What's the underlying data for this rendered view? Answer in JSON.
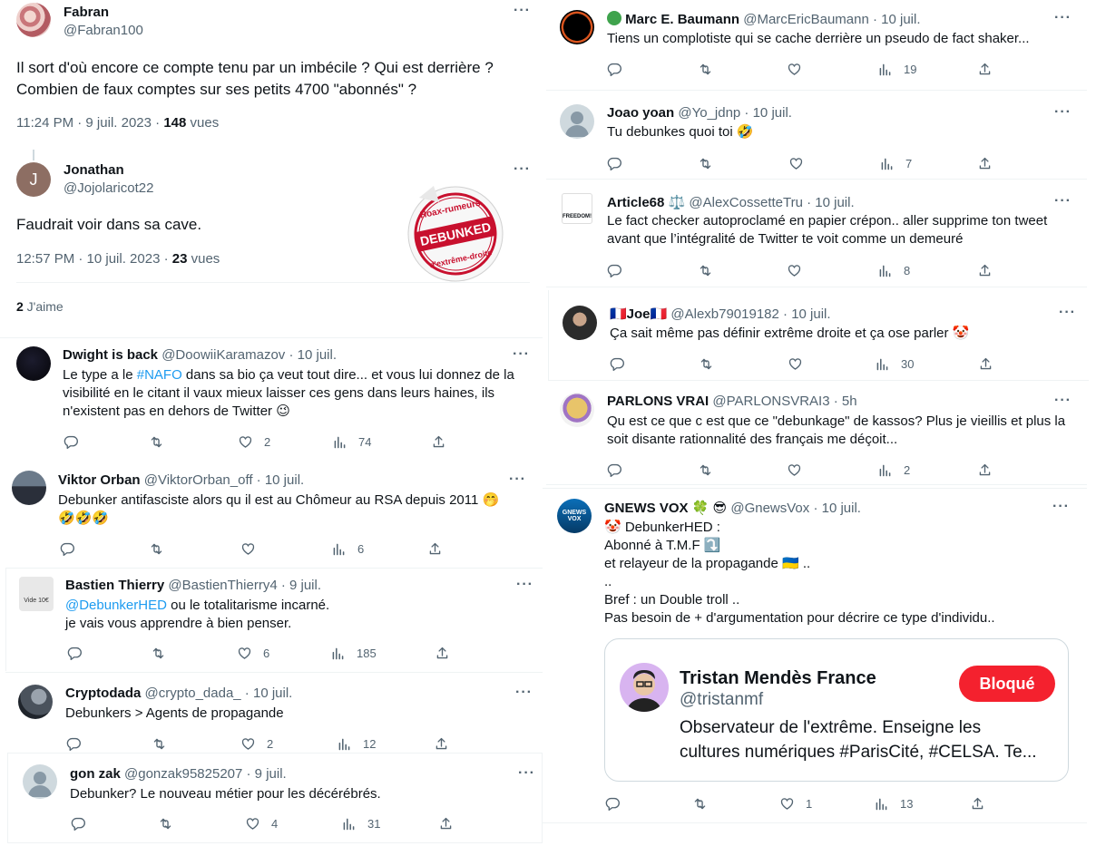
{
  "left": {
    "main": {
      "fabran": {
        "name": "Fabran",
        "handle": "@Fabran100",
        "text": "Il sort d'où encore ce compte tenu par un imbécile ? Qui est derrière ?\nCombien de faux comptes sur ses petits 4700 \"abonnés\" ?",
        "time": "11:24 PM · 9 juil. 2023 · ",
        "views": "148",
        "views_label": " vues"
      },
      "jonathan": {
        "name": "Jonathan",
        "handle": "@Jojolaricot22",
        "avatar_letter": "J",
        "text": "Faudrait voir dans sa cave.",
        "time": "12:57 PM · 10 juil. 2023 · ",
        "views": "23",
        "views_label": " vues",
        "likes_count": "2",
        "likes_label": " J'aime",
        "stamp_top": "Hoax-rumeurs",
        "stamp_mid": "DEBUNKED",
        "stamp_bottom": "d'extrême-droite"
      }
    },
    "replies": [
      {
        "name": "Dwight is back",
        "handle": "@DoowiiKaramazov · 10 juil.",
        "pre": "Le type a le ",
        "link": "#NAFO",
        "post": " dans sa bio ça veut tout dire... et vous lui donnez de la\nvisibilité en le citant il vaux mieux laisser ces gens dans leurs haines, ils\nn'existent pas en dehors de Twitter 😉",
        "likes": "2",
        "views": "74"
      },
      {
        "name": "Viktor Orban",
        "handle": "@ViktorOrban_off · 10 juil.",
        "text": "Debunker antifasciste alors qu il est au Chômeur au RSA depuis 2011 🤭\n🤣🤣🤣",
        "likes": "",
        "views": "6"
      },
      {
        "name": "Bastien Thierry",
        "handle": "@BastienThierry4 · 9 juil.",
        "link": "@DebunkerHED",
        "post": " ou le totalitarisme  incarné.\nje vais vous apprendre à bien penser.",
        "likes": "6",
        "views": "185",
        "avatar_text": "Vide 10€"
      },
      {
        "name": "Cryptodada",
        "handle": "@crypto_dada_ · 10 juil.",
        "text": "Debunkers > Agents de propagande",
        "likes": "2",
        "views": "12"
      },
      {
        "name": "gon zak",
        "handle": "@gonzak95825207 · 9 juil.",
        "text": "Debunker? Le nouveau métier pour les décérébrés.",
        "likes": "4",
        "views": "31"
      }
    ]
  },
  "right": {
    "replies": [
      {
        "name": "Marc E. Baumann",
        "handle": "@MarcEricBaumann · 10 juil.",
        "text": "Tiens un complotiste qui se cache derrière un pseudo de fact shaker...",
        "likes": "",
        "views": "19"
      },
      {
        "name": "Joao yoan",
        "handle": "@Yo_jdnp · 10 juil.",
        "text": "Tu debunkes quoi toi 🤣",
        "likes": "",
        "views": "7"
      },
      {
        "name": "Article68 ⚖️",
        "handle": "@AlexCossetteTru · 10 juil.",
        "text": "Le fact checker autoproclamé en papier crépon.. aller supprime ton tweet\navant que l’intégralité de Twitter te voit comme un demeuré",
        "likes": "",
        "views": "8",
        "avatar_text": "FREEDOM!"
      },
      {
        "name": "🇫🇷Joe🇫🇷",
        "handle": "@Alexb79019182 · 10 juil.",
        "text": "Ça sait même pas définir extrême droite et ça ose parler 🤡",
        "likes": "",
        "views": "30"
      },
      {
        "name": "PARLONS VRAI",
        "handle": "@PARLONSVRAI3 · 5h",
        "text": "Qu est ce que c est que ce \"debunkage\" de kassos? Plus je vieillis et plus la\nsoit disante rationnalité des français me déçoit...",
        "likes": "",
        "views": "2"
      },
      {
        "name": "GNEWS VOX 🍀 😎",
        "handle": "@GnewsVox · 10 juil.",
        "text": "🤡 DebunkerHED :\nAbonné à T.M.F ⤵️\net relayeur de la propagande 🇺🇦 ..\n..\nBref : un Double troll ..\nPas besoin de + d'argumentation pour décrire ce type d'individu..",
        "likes": "1",
        "views": "13",
        "avatar_text": "GNEWS VOX",
        "card": {
          "name": "Tristan Mendès France",
          "handle": "@tristanmf",
          "button": "Bloqué",
          "bio": "Observateur de l'extrême. Enseigne les\ncultures numériques #ParisCité, #CELSA. Te..."
        }
      }
    ]
  },
  "colors": {
    "accent": "#1d9bf0",
    "secondary": "#536471",
    "block": "#f4212e"
  }
}
